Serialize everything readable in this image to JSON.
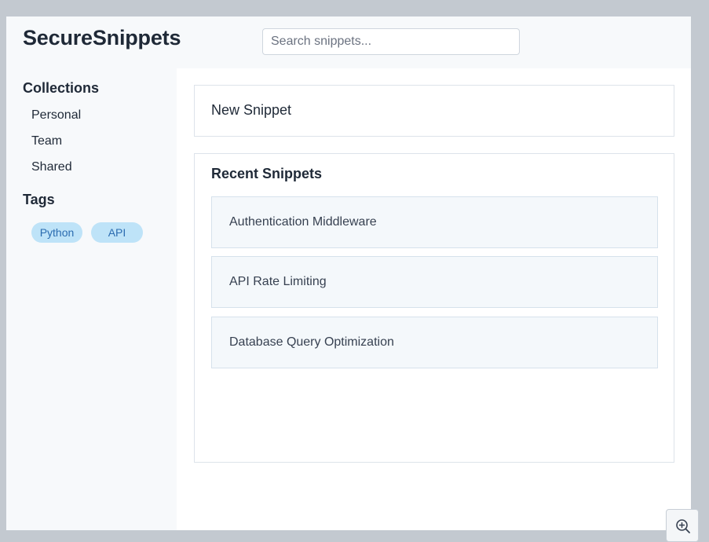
{
  "header": {
    "title": "SecureSnippets",
    "search_placeholder": "Search snippets..."
  },
  "sidebar": {
    "collections_title": "Collections",
    "collections": [
      "Personal",
      "Team",
      "Shared"
    ],
    "tags_title": "Tags",
    "tags": [
      "Python",
      "API"
    ]
  },
  "main": {
    "new_snippet_label": "New Snippet",
    "recent_title": "Recent Snippets",
    "recent_snippets": [
      "Authentication Middleware",
      "API Rate Limiting",
      "Database Query Optimization"
    ]
  },
  "icons": {
    "zoom": "zoom-in-icon"
  },
  "colors": {
    "tag_background": "#bee3f8",
    "tag_text": "#2b6cb0",
    "snippet_background": "#f4f8fb"
  }
}
